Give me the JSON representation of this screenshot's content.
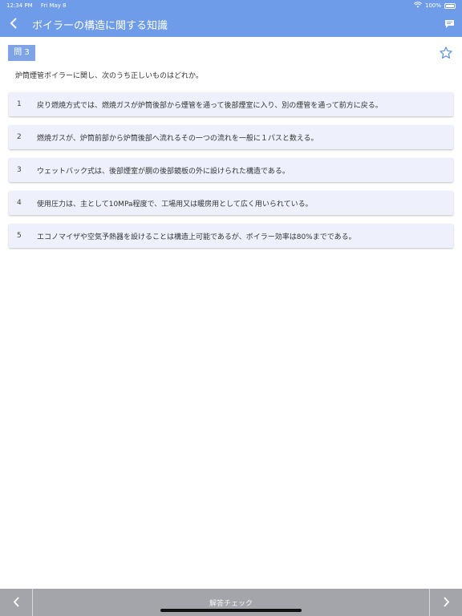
{
  "status": {
    "time": "12:34 PM",
    "date": "Fri May 8",
    "battery": "100%",
    "wifi_icon": "wifi-icon",
    "battery_icon": "battery-icon"
  },
  "nav": {
    "title": "ボイラーの構造に関する知識",
    "back_icon": "chevron-left-icon",
    "comment_icon": "comment-icon"
  },
  "question": {
    "badge": "問 3",
    "text": "炉筒煙管ボイラーに関し、次のうち正しいものはどれか。",
    "star_icon": "star-outline-icon"
  },
  "options": [
    {
      "num": "1",
      "text": "戻り燃焼方式では、燃焼ガスが炉筒後部から煙管を通って後部煙室に入り、別の煙管を通って前方に戻る。"
    },
    {
      "num": "2",
      "text": "燃焼ガスが、炉筒前部から炉筒後部へ流れるその一つの流れを一般に１パスと数える。"
    },
    {
      "num": "3",
      "text": "ウェットバック式は、後部煙室が胴の後部鏡板の外に設けられた構造である。"
    },
    {
      "num": "4",
      "text": "使用圧力は、主として10MPa程度で、工場用又は暖房用として広く用いられている。"
    },
    {
      "num": "5",
      "text": "エコノマイザや空気予熱器を設けることは構造上可能であるが、ボイラー効率は80%までである。"
    }
  ],
  "bottom": {
    "check_label": "解答チェック",
    "prev_icon": "chevron-left-icon",
    "next_icon": "chevron-right-icon"
  },
  "colors": {
    "header": "#6f9ce8",
    "badge": "#7ea4e6",
    "option_bg": "#eef0fb",
    "bottom_bar": "#a3a5aa",
    "star": "#5b8ee0"
  }
}
